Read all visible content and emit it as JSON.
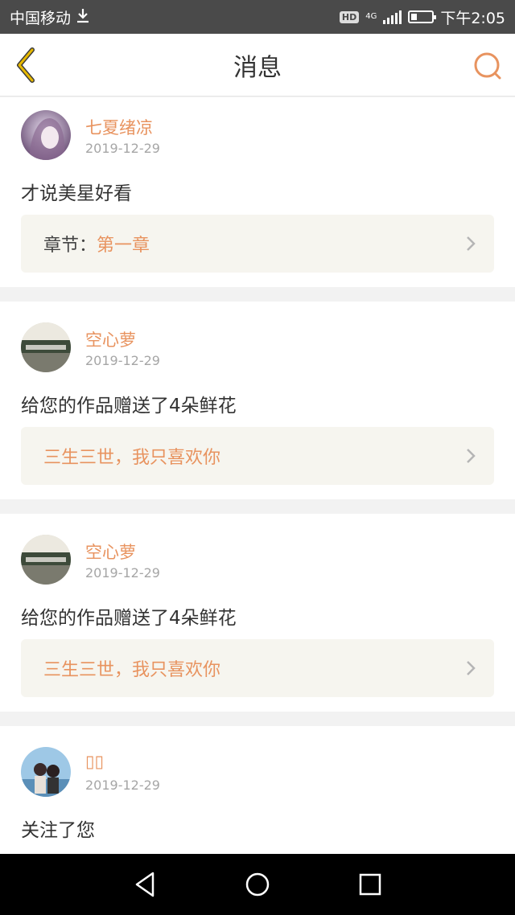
{
  "status_bar": {
    "carrier": "中国移动",
    "hd": "HD",
    "network": "4G",
    "time": "下午2:05",
    "battery_level": 0.3
  },
  "header": {
    "title": "消息",
    "back_icon": "back-chevron-icon",
    "search_icon": "search-icon"
  },
  "messages": [
    {
      "name": "七夏绪凉",
      "date": "2019-12-29",
      "text": "才说美星好看",
      "link_label": "章节：",
      "link_value": "第一章"
    },
    {
      "name": "空心萝",
      "date": "2019-12-29",
      "text": "给您的作品赠送了4朵鲜花",
      "link_title": "三生三世，我只喜欢你"
    },
    {
      "name": "空心萝",
      "date": "2019-12-29",
      "text": "给您的作品赠送了4朵鲜花",
      "link_title": "三生三世，我只喜欢你"
    },
    {
      "name": "▯▯",
      "date": "2019-12-29",
      "text": "关注了您"
    }
  ],
  "colors": {
    "accent": "#e8935f",
    "back_icon": "#e6b800",
    "link_bg": "#f6f5ef"
  }
}
